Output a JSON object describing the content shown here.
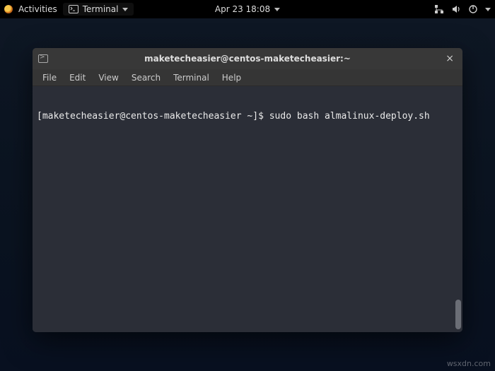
{
  "panel": {
    "activities_label": "Activities",
    "app_label": "Terminal",
    "datetime": "Apr 23  18:08"
  },
  "window": {
    "title": "maketecheasier@centos-maketecheasier:~",
    "menus": [
      "File",
      "Edit",
      "View",
      "Search",
      "Terminal",
      "Help"
    ]
  },
  "terminal": {
    "prompt": "[maketecheasier@centos-maketecheasier ~]$ ",
    "command": "sudo bash almalinux-deploy.sh"
  },
  "watermark": "wsxdn.com"
}
